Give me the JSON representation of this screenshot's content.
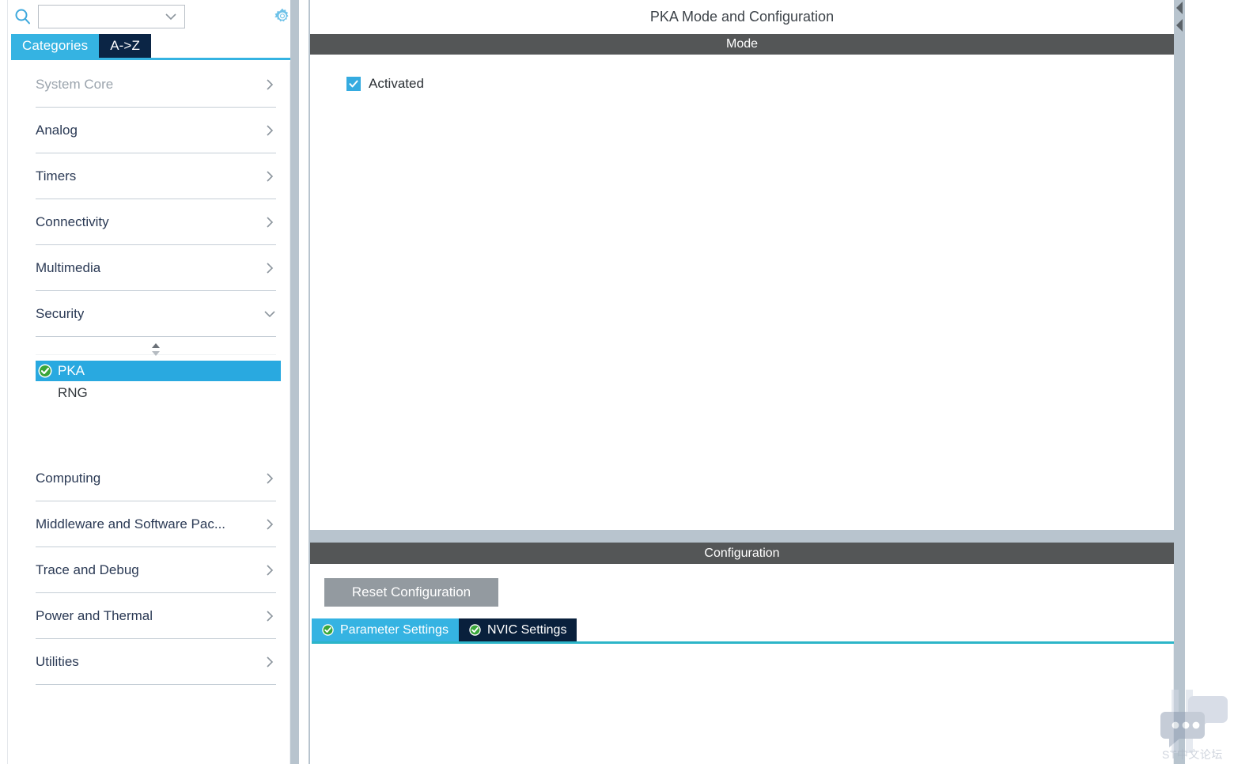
{
  "sidebar": {
    "search": {
      "value": "",
      "placeholder": "",
      "icon": "search-icon",
      "chevron_icon": "chevron-down-icon"
    },
    "settings_icon": "gear-icon",
    "tabs": [
      {
        "label": "Categories",
        "state": "active"
      },
      {
        "label": "A->Z",
        "state": "inactive"
      }
    ],
    "categories": [
      {
        "label": "System Core",
        "state": "disabled",
        "chevron": "chevron-right-icon"
      },
      {
        "label": "Analog",
        "state": "collapsed",
        "chevron": "chevron-right-icon"
      },
      {
        "label": "Timers",
        "state": "collapsed",
        "chevron": "chevron-right-icon"
      },
      {
        "label": "Connectivity",
        "state": "collapsed",
        "chevron": "chevron-right-icon"
      },
      {
        "label": "Multimedia",
        "state": "collapsed",
        "chevron": "chevron-right-icon"
      },
      {
        "label": "Security",
        "state": "expanded",
        "chevron": "chevron-down-icon"
      }
    ],
    "security_items": [
      {
        "label": "PKA",
        "selected": true,
        "status_icon": "green-check-icon"
      },
      {
        "label": "RNG",
        "selected": false,
        "status_icon": "none"
      }
    ],
    "categories_after": [
      {
        "label": "Computing",
        "state": "collapsed",
        "chevron": "chevron-right-icon"
      },
      {
        "label": "Middleware and Software Pac...",
        "state": "collapsed",
        "chevron": "chevron-right-icon"
      },
      {
        "label": "Trace and Debug",
        "state": "collapsed",
        "chevron": "chevron-right-icon"
      },
      {
        "label": "Power and Thermal",
        "state": "collapsed",
        "chevron": "chevron-right-icon"
      },
      {
        "label": "Utilities",
        "state": "collapsed",
        "chevron": "chevron-right-icon"
      }
    ]
  },
  "main": {
    "page_title": "PKA Mode and Configuration",
    "mode": {
      "header": "Mode",
      "activated": {
        "label": "Activated",
        "checked": true,
        "check_icon": "checkmark-icon"
      }
    },
    "configuration": {
      "header": "Configuration",
      "reset_button": "Reset Configuration",
      "tabs": [
        {
          "label": "Parameter Settings",
          "state": "active",
          "status_icon": "green-check-icon"
        },
        {
          "label": "NVIC Settings",
          "state": "inactive",
          "status_icon": "green-check-icon"
        }
      ]
    },
    "collapse_arrows_icon": "double-left-arrow-icon"
  },
  "watermark": {
    "text": "ST中文论坛",
    "icon": "chat-bubbles-icon"
  },
  "colors": {
    "accent_blue": "#35b3e2",
    "selected_blue": "#29a9e0",
    "dark_navy": "#0b2545",
    "header_grey": "#545657",
    "splitter_grey": "#b8c4ce",
    "button_grey": "#939aa0",
    "check_green": "#3aa63a",
    "text_navy": "#2b3a55",
    "disabled_grey": "#9ba4ad",
    "teal_underline": "#2cb5c8"
  }
}
